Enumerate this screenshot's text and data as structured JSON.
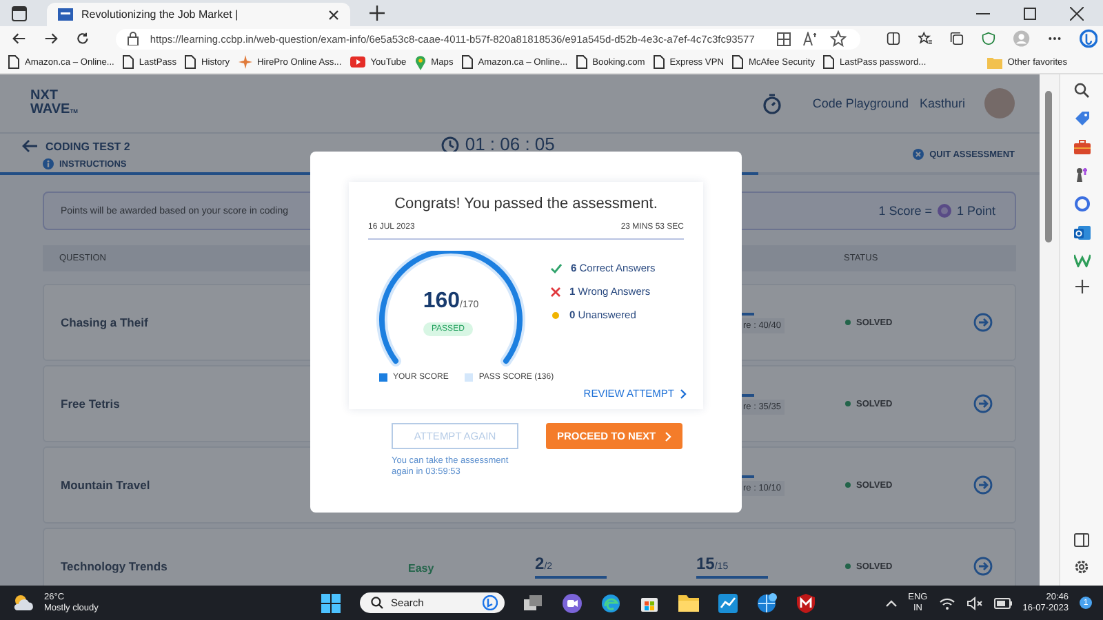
{
  "browser": {
    "tabs": [
      {
        "title": "Revolutionizing the Job Market |",
        "selected": true
      }
    ],
    "url": "https://learning.ccbp.in/web-question/exam-info/6e5a53c8-caae-4011-b57f-820a81818536/e91a545d-d52b-4e3c-a7ef-4c7c3fc93577",
    "bookmarks": [
      {
        "label": "Amazon.ca – Online...",
        "kind": "page"
      },
      {
        "label": "LastPass",
        "kind": "page"
      },
      {
        "label": "History",
        "kind": "page"
      },
      {
        "label": "HirePro Online Ass...",
        "kind": "star"
      },
      {
        "label": "YouTube",
        "kind": "video"
      },
      {
        "label": "Maps",
        "kind": "pin"
      },
      {
        "label": "Amazon.ca – Online...",
        "kind": "page"
      },
      {
        "label": "Booking.com",
        "kind": "page"
      },
      {
        "label": "Express VPN",
        "kind": "page"
      },
      {
        "label": "McAfee Security",
        "kind": "page"
      },
      {
        "label": "LastPass password...",
        "kind": "page"
      }
    ],
    "other_favorites": "Other favorites"
  },
  "header": {
    "logo_line1": "NXT",
    "logo_line2": "WAVE",
    "logo_tm": "TM",
    "code_playground": "Code Playground",
    "user": "Kasthuri"
  },
  "test": {
    "title": "CODING TEST 2",
    "instructions": "INSTRUCTIONS",
    "timer": "01 : 06 : 05",
    "quit": "QUIT ASSESSMENT",
    "progress": {
      "level": 0.73
    }
  },
  "banner": {
    "text": "Points will be awarded based on your score in coding",
    "score_left": "1 Score =",
    "score_right": "1 Point"
  },
  "table": {
    "columns": [
      "QUESTION",
      "STATUS"
    ],
    "rows": [
      {
        "name": "Chasing a Theif",
        "note": "re : 40/40",
        "status": "SOLVED"
      },
      {
        "name": "Free Tetris",
        "note": "re : 35/35",
        "status": "SOLVED"
      },
      {
        "name": "Mountain Travel",
        "note": "re : 10/10",
        "status": "SOLVED"
      },
      {
        "name": "Technology Trends",
        "difficulty": "Easy",
        "score_1": {
          "value": "2",
          "max": "/2"
        },
        "score_2": {
          "value": "15",
          "max": "/15"
        },
        "status": "SOLVED"
      }
    ]
  },
  "dialog": {
    "title": "Congrats! You passed the assessment.",
    "date": "16 JUL 2023",
    "duration": "23 MINS 53 SEC",
    "score": "160",
    "max": "/170",
    "result": "PASSED",
    "legend": [
      "YOUR SCORE",
      "PASS SCORE (136)"
    ],
    "stats": [
      {
        "kind": "correct",
        "count": "6",
        "label": "Correct Answers"
      },
      {
        "kind": "wrong",
        "count": "1",
        "label": "Wrong Answers"
      },
      {
        "kind": "unanswered",
        "count": "0",
        "label": "Unanswered"
      }
    ],
    "review": "REVIEW ATTEMPT",
    "attempt_again": {
      "label": "ATTEMPT AGAIN",
      "disabled": true
    },
    "proceed": "PROCEED TO NEXT",
    "note": "You can take the assessment again in 03:59:53"
  },
  "taskbar": {
    "temperature": "26°C",
    "weather": "Mostly cloudy",
    "search": "Search",
    "language": "ENG",
    "region": "IN",
    "time": "20:46",
    "date": "16-07-2023",
    "notifications": "1"
  }
}
